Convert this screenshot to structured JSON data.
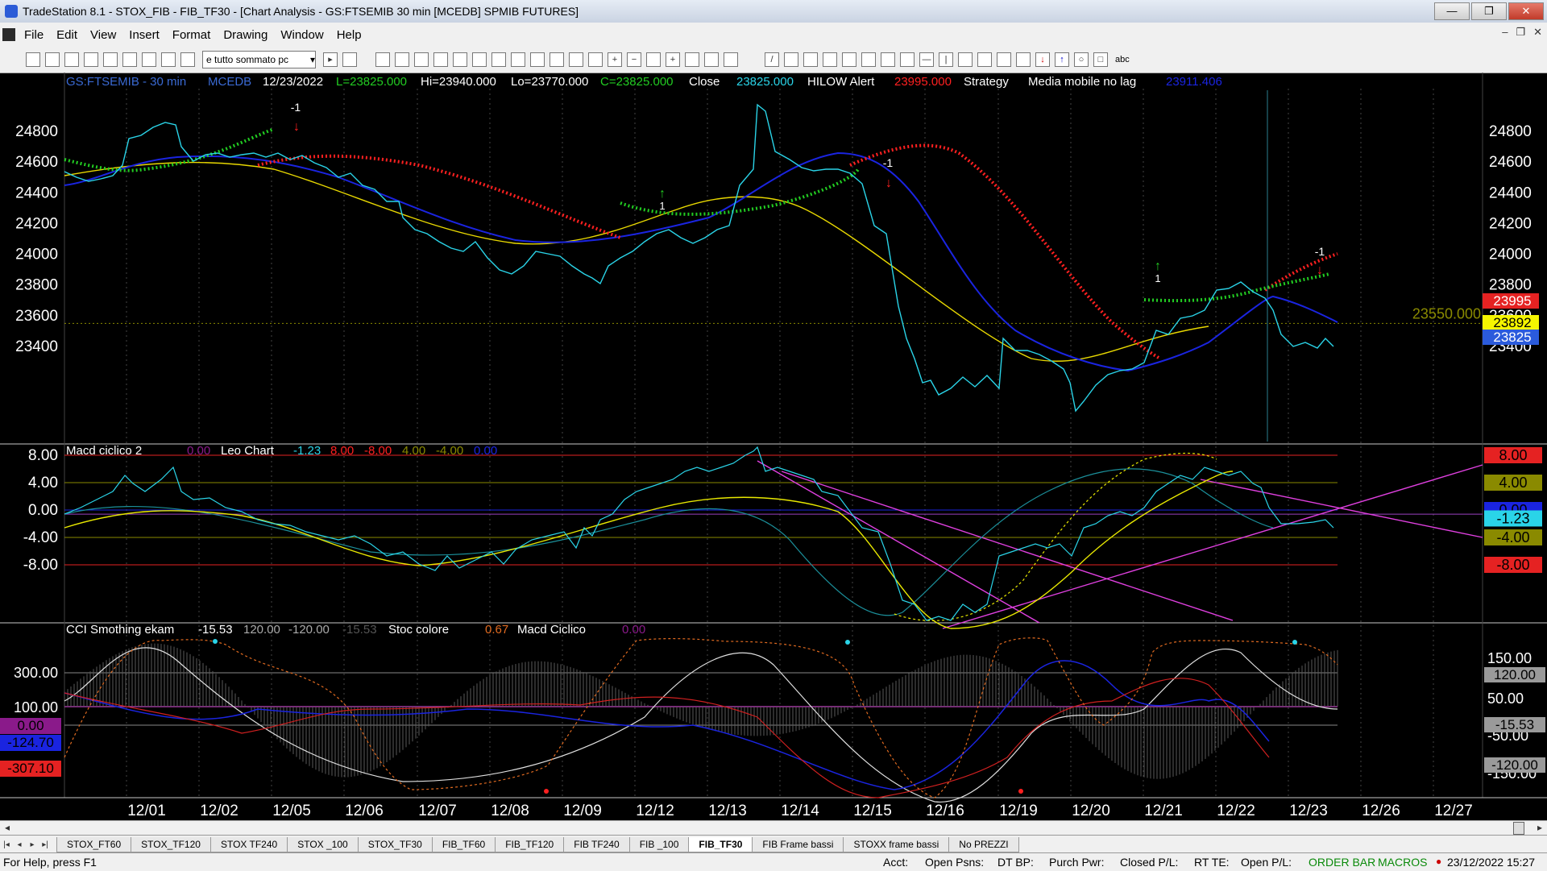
{
  "window": {
    "title": "TradeStation 8.1 - STOX_FIB - FIB_TF30 - [Chart Analysis - GS:FTSEMIB  30 min  [MCEDB] SPMIB FUTURES]",
    "minimize": "—",
    "maximize": "❐",
    "close": "✕"
  },
  "menu": [
    "File",
    "Edit",
    "View",
    "Insert",
    "Format",
    "Drawing",
    "Window",
    "Help"
  ],
  "mdi": [
    "–",
    "❐",
    "✕"
  ],
  "toolbar": {
    "combo_value": "e tutto sommato pc",
    "text_tool": "abc"
  },
  "chart_data": [
    {
      "type": "line",
      "name": "price",
      "header": {
        "symbol": "GS:FTSEMIB - 30 min",
        "source": "MCEDB",
        "date": "12/23/2022",
        "ohlc": {
          "L": "L=23825.000",
          "Hi": "Hi=23940.000",
          "Lo": "Lo=23770.000",
          "C": "C=23825.000"
        },
        "close_label": "Close",
        "close_value": "23825.000",
        "hilow_label": "HILOW Alert",
        "hilow_value": "23995.000",
        "strategy_label": "Strategy",
        "media_label": "Media mobile no lag",
        "media_value": "23911.406"
      },
      "y_ticks": [
        "24800",
        "24600",
        "24400",
        "24200",
        "24000",
        "23800",
        "23600",
        "23400"
      ],
      "ylim": [
        23350,
        24900
      ],
      "level_value": 23550,
      "level_label": "23550.000",
      "right_labels": [
        {
          "text": "23995",
          "color": "#e52222"
        },
        {
          "text": "23892",
          "color": "#f5f500"
        },
        {
          "text": "23825",
          "color": "#2b5bdc"
        }
      ],
      "signals": [
        "-1",
        "1",
        "-1",
        "1",
        "-1"
      ],
      "series": [
        {
          "name": "Close",
          "color": "#2ad4e8"
        },
        {
          "name": "Media mobile no lag",
          "color": "#1a24e0"
        }
      ]
    },
    {
      "type": "line",
      "name": "macd",
      "header": {
        "title": "Macd ciclico 2",
        "v0": "0.00",
        "leo_label": "Leo Chart",
        "values": [
          "-1.23",
          "8.00",
          "-8.00",
          "4.00",
          "-4.00",
          "0.00"
        ]
      },
      "y_ticks": [
        "8.00",
        "4.00",
        "0.00",
        "-4.00",
        "-8.00"
      ],
      "ylim": [
        -10.5,
        10
      ],
      "levels": [
        8,
        4,
        0,
        -4,
        -8
      ],
      "right_labels": [
        {
          "text": "8.00",
          "color": "#e52222"
        },
        {
          "text": "4.00",
          "color": "#8a8a00"
        },
        {
          "text": "0.00",
          "color": "#1a24e0"
        },
        {
          "text": "-1.23",
          "color": "#2ad4e8"
        },
        {
          "text": "-4.00",
          "color": "#8a8a00"
        },
        {
          "text": "-8.00",
          "color": "#e52222"
        }
      ]
    },
    {
      "type": "line",
      "name": "cci",
      "header": {
        "title": "CCI Smothing ekam",
        "values": [
          "-15.53",
          "120.00",
          "-120.00",
          "-15.53"
        ],
        "stoc_label": "Stoc colore",
        "stoc_value": "0.67",
        "macd_label": "Macd Ciclico",
        "macd_value": "0.00"
      },
      "y_ticks": [
        "300.00",
        "100.00"
      ],
      "right_ticks": [
        "150.00",
        "50.00",
        "-50.00",
        "-150.00"
      ],
      "right_labels": [
        {
          "text": "120.00",
          "color": "#9a9a9a"
        },
        {
          "text": "-15.53",
          "color": "#9a9a9a"
        },
        {
          "text": "-120.00",
          "color": "#9a9a9a"
        }
      ],
      "left_labels": [
        {
          "text": "0.00",
          "color": "#8a1a8a"
        },
        {
          "text": "-124.70",
          "color": "#1a24e0"
        },
        {
          "text": "-307.10",
          "color": "#e52222"
        }
      ]
    }
  ],
  "x_axis": {
    "labels": [
      "12/01",
      "12/02",
      "12/05",
      "12/06",
      "12/07",
      "12/08",
      "12/09",
      "12/12",
      "12/13",
      "12/14",
      "12/15",
      "12/16",
      "12/19",
      "12/20",
      "12/21",
      "12/22",
      "12/23",
      "12/26",
      "12/27"
    ]
  },
  "tabs": [
    "STOX_FT60",
    "STOX_TF120",
    "STOX TF240",
    "STOX _100",
    "STOX_TF30",
    "FIB_TF60",
    "FIB_TF120",
    "FIB TF240",
    "FIB _100",
    "FIB_TF30",
    "FIB Frame bassi",
    "STOXX frame bassi",
    "No PREZZI"
  ],
  "active_tab": "FIB_TF30",
  "status": {
    "help": "For Help, press F1",
    "acct": "Acct:",
    "open_psns": "Open Psns:",
    "dt_bp": "DT BP:",
    "purch_pwr": "Purch Pwr:",
    "closed_pl": "Closed P/L:",
    "rt_te": "RT TE:",
    "open_pl": "Open P/L:",
    "order_bar": "ORDER BAR",
    "macros": "MACROS",
    "datetime": "23/12/2022 15:27"
  }
}
